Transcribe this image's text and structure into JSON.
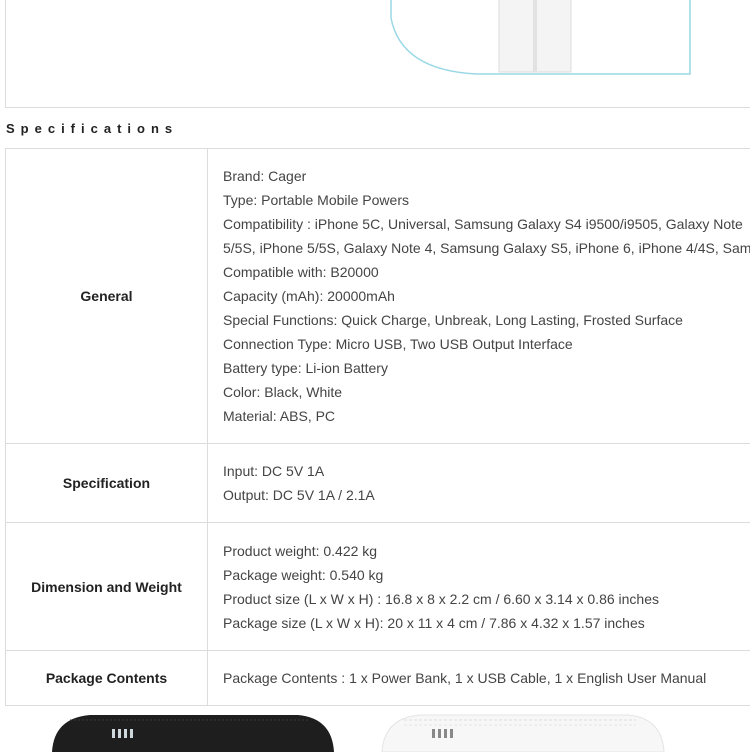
{
  "specifications": {
    "heading": "Specifications",
    "rows": [
      {
        "label": "General",
        "lines": [
          "Brand: Cager",
          "Type: Portable Mobile Powers",
          "Compatibility : iPhone 5C, Universal, Samsung Galaxy S4 i9500/i9505, Galaxy Note",
          "5/5S, iPhone 5/5S, Galaxy Note 4, Samsung Galaxy S5, iPhone 6, iPhone 4/4S, Sam",
          "Compatible with: B20000",
          "Capacity (mAh): 20000mAh",
          "Special Functions: Quick Charge, Unbreak, Long Lasting, Frosted Surface",
          "Connection Type: Micro USB, Two USB Output Interface",
          "Battery type: Li-ion Battery",
          "Color: Black, White",
          "Material: ABS, PC"
        ]
      },
      {
        "label": "Specification",
        "lines": [
          "Input: DC 5V 1A",
          "Output: DC 5V 1A / 2.1A"
        ]
      },
      {
        "label": "Dimension and Weight",
        "lines": [
          "Product weight: 0.422 kg",
          "Package weight: 0.540 kg",
          "Product size (L x W x H) : 16.8 x 8 x 2.2 cm / 6.60 x 3.14 x 0.86 inches",
          "Package size (L x W x H): 20 x 11 x 4 cm / 7.86 x 4.32 x 1.57 inches"
        ]
      },
      {
        "label": "Package Contents",
        "lines": [
          "Package Contents : 1 x Power Bank, 1 x USB Cable, 1 x English User Manual"
        ]
      }
    ]
  },
  "images": {
    "top": "product-photo-white-power-bank",
    "bottom_left": "black-power-bank-photo",
    "bottom_right": "white-power-bank-photo"
  }
}
